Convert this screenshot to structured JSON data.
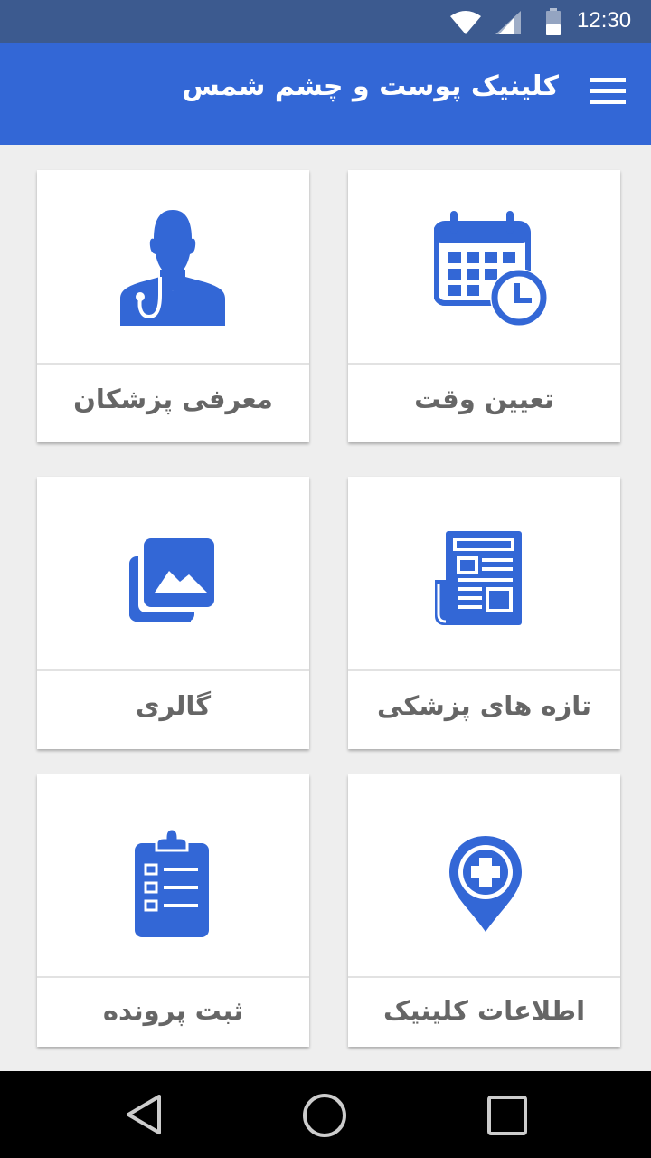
{
  "status_bar": {
    "time": "12:30"
  },
  "app_bar": {
    "title": "کلینیک پوست و چشم شمس"
  },
  "tiles": {
    "appointment": {
      "label": "تعیین وقت",
      "icon": "calendar-clock-icon"
    },
    "doctors": {
      "label": "معرفی پزشکان",
      "icon": "doctor-icon"
    },
    "news": {
      "label": "تازه های پزشکی",
      "icon": "newspaper-icon"
    },
    "gallery": {
      "label": "گالری",
      "icon": "gallery-icon"
    },
    "clinic_info": {
      "label": "اطلاعات کلینیک",
      "icon": "medical-location-icon"
    },
    "record": {
      "label": "ثبت پرونده",
      "icon": "clipboard-checklist-icon"
    }
  },
  "colors": {
    "status_bar": "#3c5a8f",
    "app_bar": "#3367d6",
    "icon": "#3367d6",
    "label": "#666666",
    "background": "#eeeeee"
  }
}
